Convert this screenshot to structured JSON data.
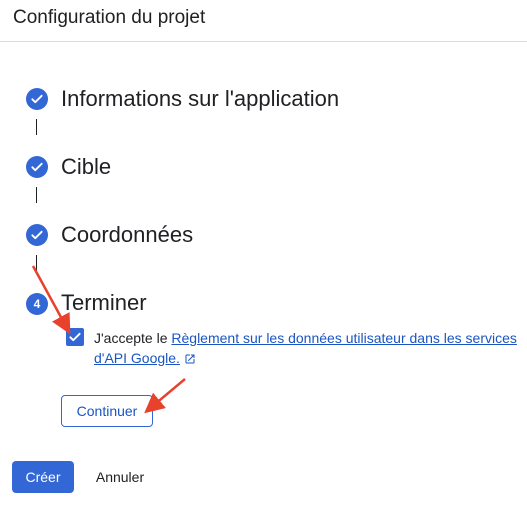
{
  "header": {
    "title": "Configuration du projet"
  },
  "steps": [
    {
      "label": "Informations sur l'application",
      "status": "completed",
      "icon": "check-icon"
    },
    {
      "label": "Cible",
      "status": "completed",
      "icon": "check-icon"
    },
    {
      "label": "Coordonnées",
      "status": "completed",
      "icon": "check-icon"
    },
    {
      "label": "Terminer",
      "status": "current",
      "number": "4"
    }
  ],
  "agreement": {
    "checked": true,
    "prefix": "J'accepte le ",
    "link_text": "Règlement sur les données utilisateur dans les services d'API Google.",
    "link_icon": "open-in-new-icon"
  },
  "buttons": {
    "continue": "Continuer",
    "create": "Créer",
    "cancel": "Annuler"
  },
  "colors": {
    "accent": "#3367d6",
    "link": "#1a55c3",
    "annotation_arrow": "#e8412c",
    "divider": "#dadce0"
  }
}
